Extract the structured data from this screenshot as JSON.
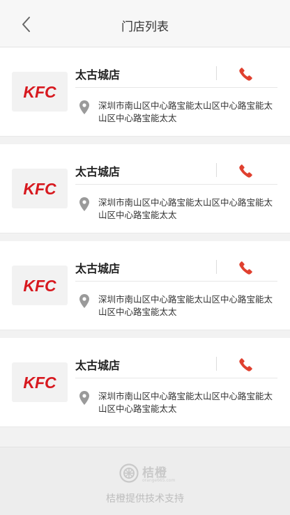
{
  "header": {
    "title": "门店列表",
    "back_icon": "chevron-left-icon"
  },
  "stores": [
    {
      "logo_text": "KFC",
      "name": "太古城店",
      "address": "深圳市南山区中心路宝能太山区中心路宝能太山区中心路宝能太太",
      "phone_icon": "phone-icon",
      "location_icon": "map-pin-icon"
    },
    {
      "logo_text": "KFC",
      "name": "太古城店",
      "address": "深圳市南山区中心路宝能太山区中心路宝能太山区中心路宝能太太",
      "phone_icon": "phone-icon",
      "location_icon": "map-pin-icon"
    },
    {
      "logo_text": "KFC",
      "name": "太古城店",
      "address": "深圳市南山区中心路宝能太山区中心路宝能太山区中心路宝能太太",
      "phone_icon": "phone-icon",
      "location_icon": "map-pin-icon"
    },
    {
      "logo_text": "KFC",
      "name": "太古城店",
      "address": "深圳市南山区中心路宝能太山区中心路宝能太山区中心路宝能太太",
      "phone_icon": "phone-icon",
      "location_icon": "map-pin-icon"
    }
  ],
  "footer": {
    "brand_name": "桔橙",
    "brand_domain": "orange665.com",
    "support_text": "桔橙提供技术支持"
  },
  "colors": {
    "kfc_red": "#d7191f",
    "phone_red": "#e0402f",
    "pin_gray": "#9a9a9a",
    "footer_gray": "#c9c9c9"
  }
}
